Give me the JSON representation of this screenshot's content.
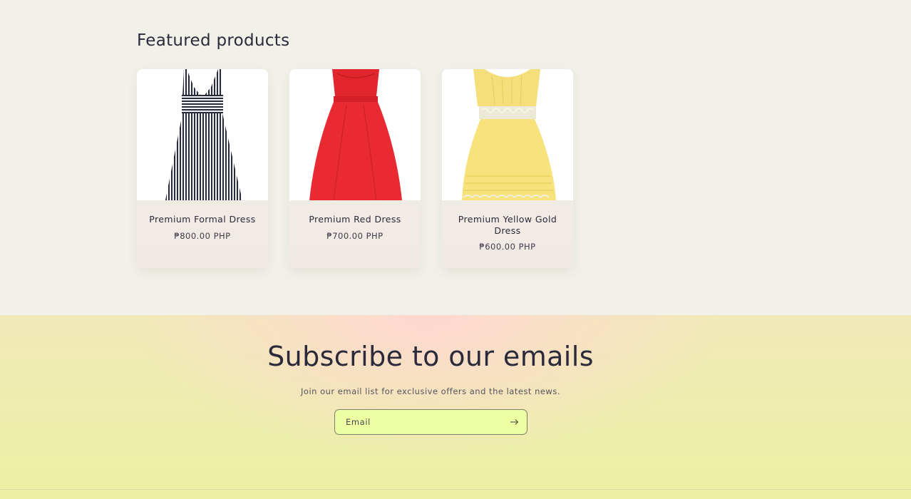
{
  "featured": {
    "title": "Featured products",
    "products": [
      {
        "name": "Premium Formal Dress",
        "price": "₱800.00 PHP",
        "image": "striped-dress"
      },
      {
        "name": "Premium Red Dress",
        "price": "₱700.00 PHP",
        "image": "red-dress"
      },
      {
        "name": "Premium Yellow Gold Dress",
        "price": "₱600.00 PHP",
        "image": "yellow-dress"
      }
    ]
  },
  "newsletter": {
    "title": "Subscribe to our emails",
    "subtitle": "Join our email list for exclusive offers and the latest news.",
    "email_placeholder": "Email",
    "submit_icon": "arrow-right-icon"
  },
  "colors": {
    "page_bg": "#f1f0e9",
    "text": "#2b2a3a",
    "input_bg": "#eeffa3",
    "banner_pink": "#ffd6d2",
    "banner_yellow": "#eaf1a4"
  }
}
